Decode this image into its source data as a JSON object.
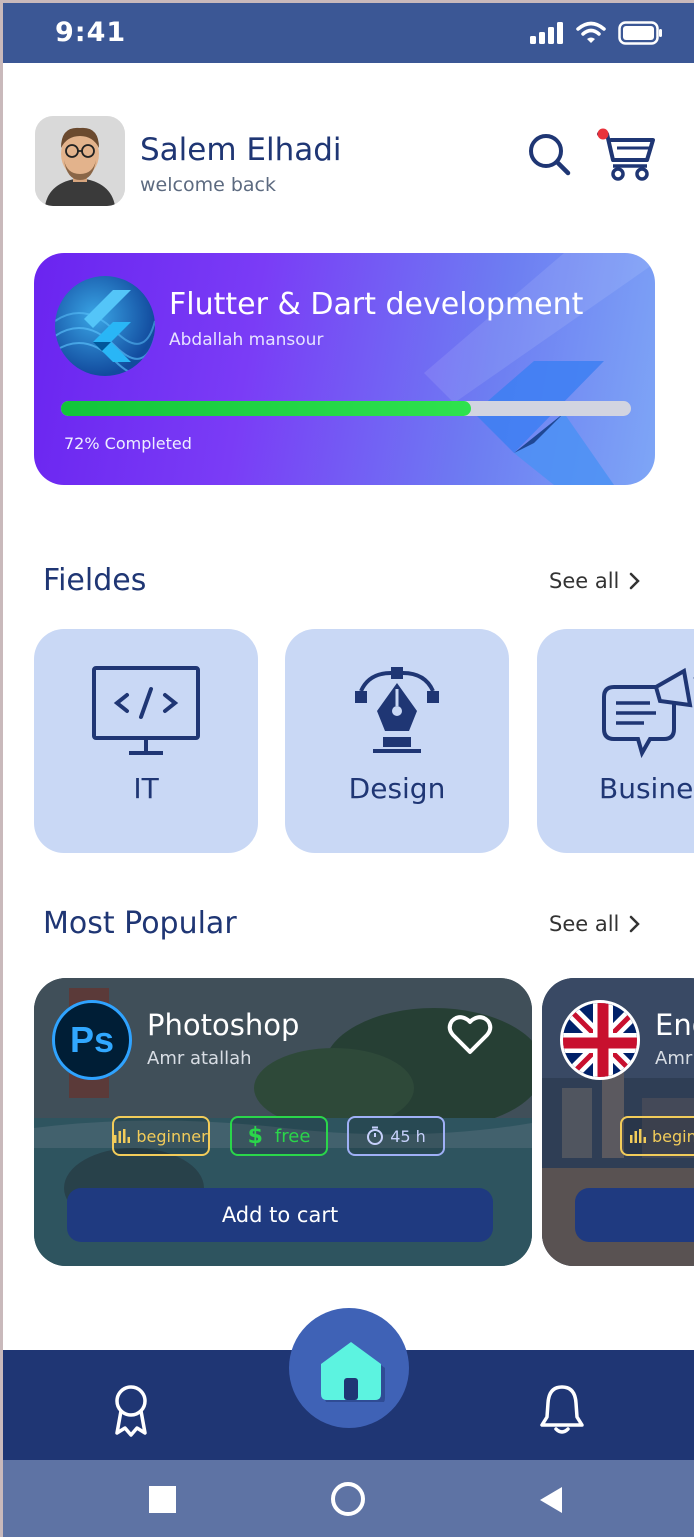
{
  "status": {
    "time": "9:41"
  },
  "user": {
    "name": "Salem Elhadi",
    "subtitle": "welcome back"
  },
  "current_course": {
    "title": "Flutter & Dart development",
    "author": "Abdallah mansour",
    "progress_fraction": 0.72,
    "progress_label": "72% Completed"
  },
  "fields_section": {
    "title": "Fieldes",
    "see_all": "See all",
    "items": [
      {
        "label": "IT",
        "icon": "monitor-code-icon"
      },
      {
        "label": "Design",
        "icon": "pen-tool-icon"
      },
      {
        "label": "Business",
        "icon": "chat-megaphone-icon"
      }
    ]
  },
  "popular_section": {
    "title": "Most Popular",
    "see_all": "See all",
    "courses": [
      {
        "logo_text": "Ps",
        "title": "Photoshop",
        "author": "Amr atallah",
        "level": "beginner",
        "price": "free",
        "price_symbol": "$",
        "duration": "45 h",
        "button": "Add to cart"
      },
      {
        "title": "Eng",
        "author": "Amr",
        "level": "beginn"
      }
    ]
  },
  "colors": {
    "primary": "#1f3674",
    "status_bar": "#3b5795",
    "card_light": "#c9d8f5",
    "progress": "#12c43a",
    "home_button": "#5cf3e0"
  }
}
